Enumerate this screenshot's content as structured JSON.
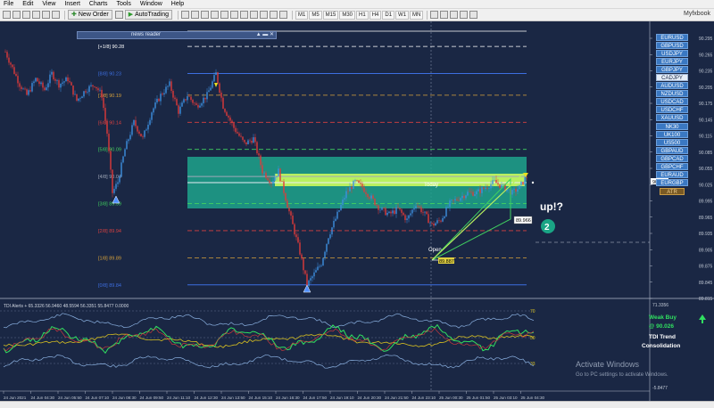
{
  "menu": [
    "File",
    "Edit",
    "View",
    "Insert",
    "Charts",
    "Tools",
    "Window",
    "Help"
  ],
  "toolbar": {
    "new_order": "New Order",
    "autotrading": "AutoTrading",
    "timeframes": [
      "M1",
      "M5",
      "M15",
      "M30",
      "H1",
      "H4",
      "D1",
      "W1",
      "MN"
    ],
    "right_label": "Myfxbook"
  },
  "news_reader": {
    "label": "news reader",
    "controls": "▲ ▬ ✕"
  },
  "symbols": [
    "EURUSD",
    "GBPUSD",
    "USDJPY",
    "EURJPY",
    "GBPJPY",
    "CADJPY",
    "AUDUSD",
    "NZDUSD",
    "USDCAD",
    "USDCHF",
    "XAUUSD",
    "NK30",
    "UK100",
    "US500",
    "GBPAUD",
    "GBPCAD",
    "GBPCHF",
    "EURAUD",
    "EURGBP"
  ],
  "active_symbol": "CADJPY",
  "atr_button": "ATR",
  "murrey_labels": [
    {
      "text": "[+1/8] 90.28",
      "price": 90.28,
      "color": "#ffffff"
    },
    {
      "text": "[8/8] 90.23",
      "price": 90.23,
      "color": "#3d6ee0"
    },
    {
      "text": "[7/8] 90.19",
      "price": 90.19,
      "color": "#d8a23a"
    },
    {
      "text": "[6/8] 90.14",
      "price": 90.14,
      "color": "#d84040"
    },
    {
      "text": "[5/8] 90.09",
      "price": 90.09,
      "color": "#40d060"
    },
    {
      "text": "[4/8] 90.04",
      "price": 90.04,
      "color": "#a0a8b8"
    },
    {
      "text": "[3/8] 89.99",
      "price": 89.99,
      "color": "#40d060"
    },
    {
      "text": "[2/8] 89.94",
      "price": 89.94,
      "color": "#d84040"
    },
    {
      "text": "[1/8] 89.89",
      "price": 89.89,
      "color": "#d8a23a"
    },
    {
      "text": "[0/8] 89.84",
      "price": 89.84,
      "color": "#3d6ee0"
    }
  ],
  "price_axis": [
    "90.295",
    "90.265",
    "90.235",
    "90.205",
    "90.175",
    "90.145",
    "90.115",
    "90.085",
    "90.055",
    "90.025",
    "89.995",
    "89.965",
    "89.935",
    "89.905",
    "89.875",
    "89.845",
    "89.815"
  ],
  "current_price": "90.041",
  "today_label": "Today",
  "open_label": "Open",
  "price_tag_1": "89.966",
  "price_tag_2": "89.887",
  "annotation": "up!?",
  "annotation_number": "2",
  "tdi": {
    "header": "TDI Alerts + 65.3326 56.9460 48.5594 56.3351 55.8477 0.0000",
    "level_top": "70",
    "level_mid": "50",
    "level_bottom": "33",
    "signal_label": "Weak Buy",
    "signal_price": "@ 90.026",
    "trend_label": "TDI Trend",
    "trend_value": "Consolidation"
  },
  "tdi_axis": [
    "71.3356",
    "-5.8477"
  ],
  "time_axis": [
    "24 Jun 2021",
    "24 Jun 04:30",
    "24 Jun 05:50",
    "24 Jun 07:10",
    "24 Jun 08:30",
    "24 Jun 09:50",
    "24 Jun 11:10",
    "24 Jun 12:30",
    "24 Jun 13:50",
    "24 Jun 15:10",
    "24 Jun 16:30",
    "24 Jun 17:50",
    "24 Jun 19:10",
    "24 Jun 20:30",
    "24 Jun 21:50",
    "24 Jun 23:10",
    "25 Jun 00:30",
    "25 Jun 01:50",
    "25 Jun 03:10",
    "25 Jun 04:30"
  ],
  "watermark": {
    "title": "Activate Windows",
    "subtitle": "Go to PC settings to activate Windows."
  },
  "colors": {
    "background": "#1a2744",
    "bull": "#3d8fe0",
    "bear": "#e03a3a",
    "zone": "#1fa58c",
    "zone_band": "#b8f060",
    "annotation_circle": "#1aa585",
    "tdi_green": "#30e060",
    "tdi_yellow": "#d8c020",
    "tdi_bands": "#8ab0e0"
  }
}
